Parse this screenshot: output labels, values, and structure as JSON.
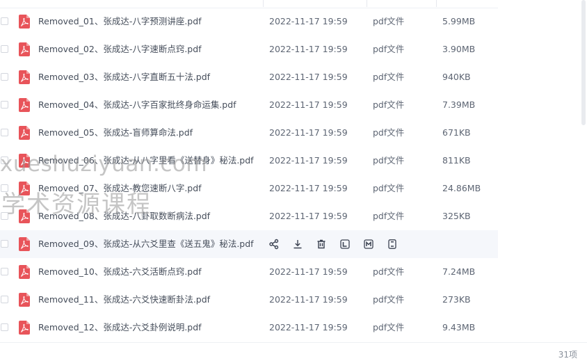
{
  "files": [
    {
      "name": "Removed_01、张成达-八字预测讲座.pdf",
      "date": "2022-11-17 19:59",
      "type": "pdf文件",
      "size": "5.99MB"
    },
    {
      "name": "Removed_02、张成达-八字速断点窍.pdf",
      "date": "2022-11-17 19:59",
      "type": "pdf文件",
      "size": "3.90MB"
    },
    {
      "name": "Removed_03、张成达-八字直断五十法.pdf",
      "date": "2022-11-17 19:59",
      "type": "pdf文件",
      "size": "940KB"
    },
    {
      "name": "Removed_04、张成达-八字百家批终身命运集.pdf",
      "date": "2022-11-17 19:59",
      "type": "pdf文件",
      "size": "7.39MB"
    },
    {
      "name": "Removed_05、张成达-盲师算命法.pdf",
      "date": "2022-11-17 19:59",
      "type": "pdf文件",
      "size": "671KB"
    },
    {
      "name": "Removed_06、张成达-从八字里看《送替身》秘法.pdf",
      "date": "2022-11-17 19:59",
      "type": "pdf文件",
      "size": "811KB"
    },
    {
      "name": "Removed_07、张成达-教您速断八字.pdf",
      "date": "2022-11-17 19:59",
      "type": "pdf文件",
      "size": "24.86MB"
    },
    {
      "name": "Removed_08、张成达-八卦取数断病法.pdf",
      "date": "2022-11-17 19:59",
      "type": "pdf文件",
      "size": "325KB"
    },
    {
      "name": "Removed_09、张成达-从六爻里查《送五鬼》秘法.pdf",
      "hover": true
    },
    {
      "name": "Removed_10、张成达-六爻活断点窍.pdf",
      "date": "2022-11-17 19:59",
      "type": "pdf文件",
      "size": "7.24MB"
    },
    {
      "name": "Removed_11、张成达-六爻快速断卦法.pdf",
      "date": "2022-11-17 19:59",
      "type": "pdf文件",
      "size": "273KB"
    },
    {
      "name": "Removed_12、张成达-六爻卦例说明.pdf",
      "date": "2022-11-17 19:59",
      "type": "pdf文件",
      "size": "9.43MB"
    }
  ],
  "hover_actions": [
    "share-icon",
    "download-icon",
    "delete-icon",
    "text-extract-icon",
    "markdown-icon",
    "more-file-icon"
  ],
  "footer": {
    "count": "31项"
  },
  "watermark": {
    "line1": "xueshuziyuan.com",
    "line2": "学术资源课程"
  },
  "colors": {
    "pdf_icon": "#e8545a",
    "hover_row": "#f5f7fb",
    "text": "#454d5a"
  }
}
